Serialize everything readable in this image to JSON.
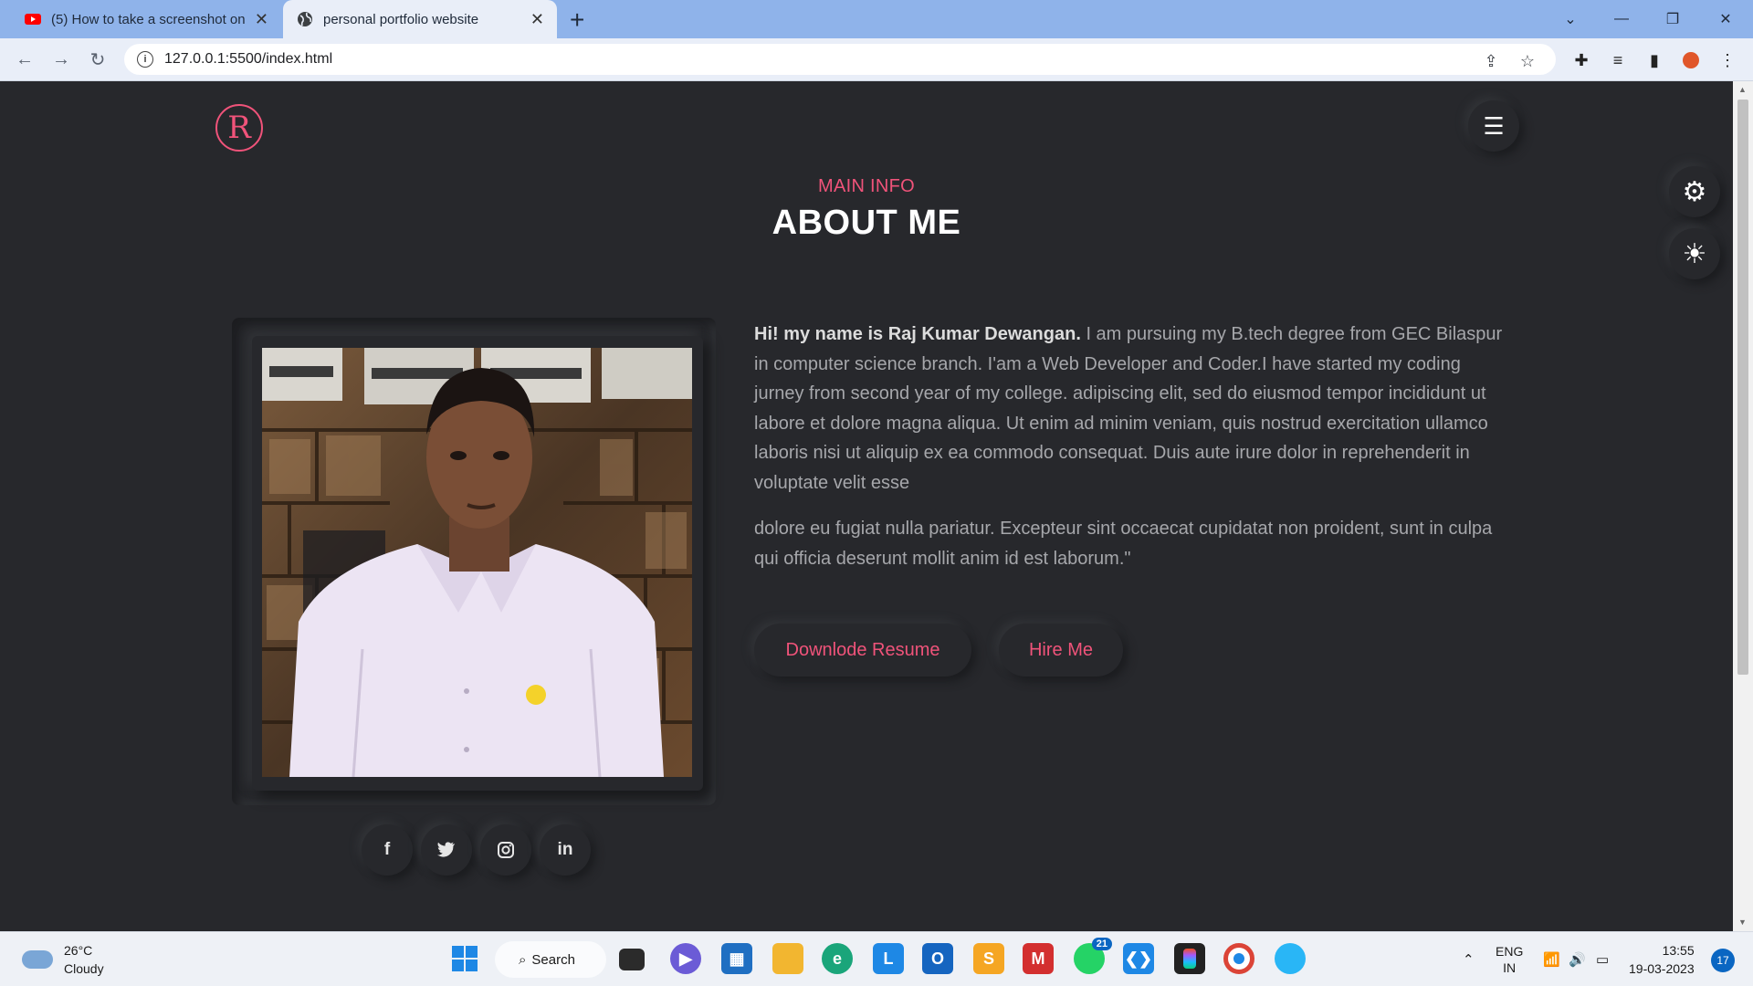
{
  "browser": {
    "tabs": [
      {
        "title": "(5) How to take a screenshot on",
        "icon": "youtube-icon",
        "active": false
      },
      {
        "title": "personal portfolio website",
        "icon": "globe-icon",
        "active": true
      }
    ],
    "url": "127.0.0.1:5500/index.html"
  },
  "site": {
    "logo_letter": "R",
    "section_subtitle": "MAIN INFO",
    "section_title": "ABOUT ME",
    "intro_bold": "Hi! my name is Raj Kumar Dewangan.",
    "intro_text": " I am pursuing my B.tech degree from GEC Bilaspur in computer science branch. I'am a Web Developer and Coder.I have started my coding jurney from second year of my college. adipiscing elit, sed do eiusmod tempor incididunt ut labore et dolore magna aliqua. Ut enim ad minim veniam, quis nostrud exercitation ullamco laboris nisi ut aliquip ex ea commodo consequat. Duis aute irure dolor in reprehenderit in voluptate velit esse",
    "paragraph2": "dolore eu fugiat nulla pariatur. Excepteur sint occaecat cupidatat non proident, sunt in culpa qui officia deserunt mollit anim id est laborum.\"",
    "buttons": {
      "resume": "Downlode Resume",
      "hire": "Hire Me"
    },
    "social": [
      "f",
      "twitter-icon",
      "instagram-icon",
      "in"
    ],
    "colors": {
      "accent": "#f0537a",
      "background": "#27282c"
    }
  },
  "taskbar": {
    "weather_temp": "26°C",
    "weather_desc": "Cloudy",
    "search_label": "Search",
    "whatsapp_badge": "21",
    "lang": "ENG",
    "region": "IN",
    "time": "13:55",
    "date": "19-03-2023",
    "notifications": "17"
  }
}
